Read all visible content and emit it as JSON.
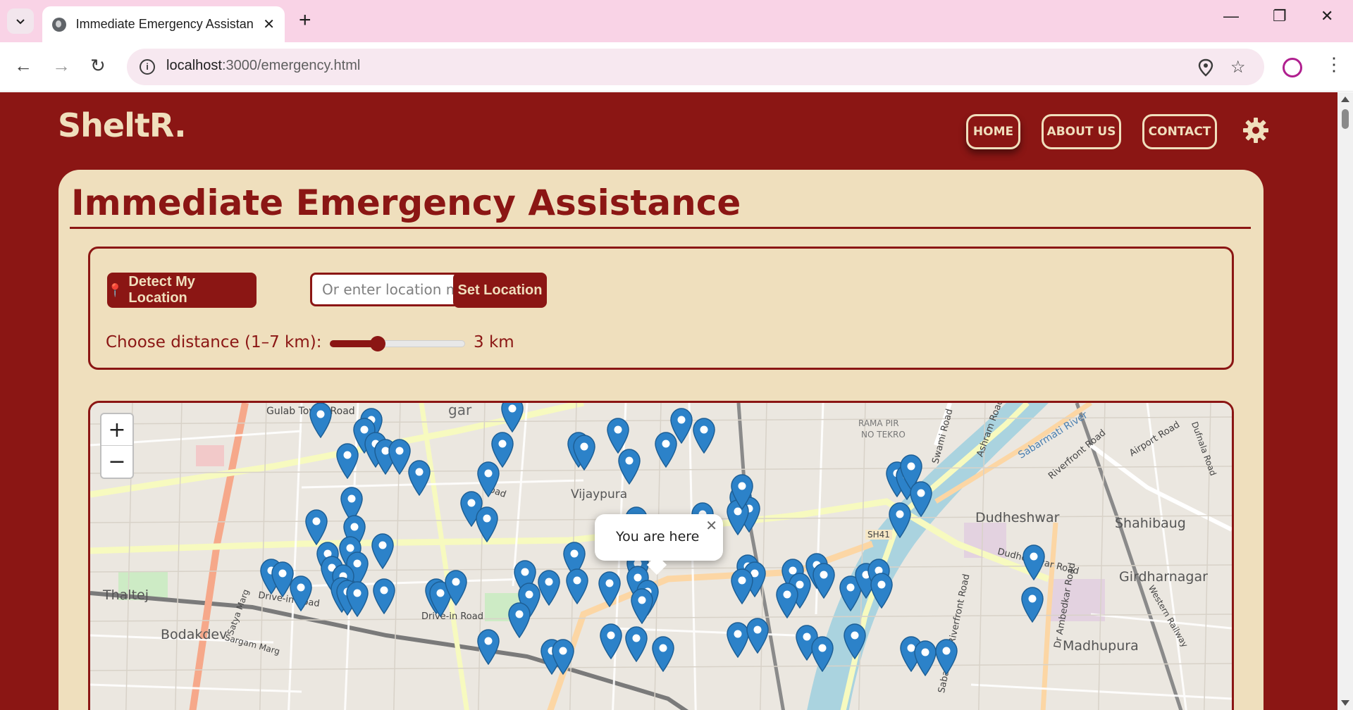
{
  "browser": {
    "tab_title": "Immediate Emergency Assistance",
    "url_host": "localhost",
    "url_path": ":3000/emergency.html"
  },
  "site": {
    "brand": "SheltR.",
    "nav": {
      "home": "HOME",
      "about": "ABOUT US",
      "contact": "CONTACT"
    }
  },
  "main": {
    "title": "Immediate Emergency Assistance",
    "detect_button": "Detect My Location",
    "location_placeholder": "Or enter location manually",
    "set_button": "Set Location",
    "distance_label": "Choose distance (1–7 km):",
    "distance_value": "3 km",
    "distance_km": 3,
    "distance_min": 1,
    "distance_max": 7
  },
  "map": {
    "zoom_in": "+",
    "zoom_out": "−",
    "popup_text": "You are here",
    "labels": {
      "gulab_tower_road": "Gulab Tower Road",
      "gar": "gar",
      "rama_pir": "RAMA PIR",
      "no_tekro": "NO TEKRO",
      "ashram_road": "Ashram Road",
      "sabarmati_river": "Sabarmati River",
      "riverfront_road": "Riverfront Road",
      "airport_road": "Airport Road",
      "dudheshwar": "Dudheshwar",
      "shahibaug": "Shahibaug",
      "girdharnagar": "Girdharnagar",
      "dudheshwar_road": "Dudheshwar Road",
      "vijaypura": "Vijaypura",
      "thaltej": "Thaltej",
      "bodakdev": "Bodakdev",
      "drive_in_road": "Drive-in Road",
      "drive_in_road2": "Drive-in Road",
      "sargam_marg": "Sargam Marg",
      "satya_marg": "Satya Marg",
      "madhupura": "Madhupura",
      "sh41": "SH41",
      "dr_ambedkar_road": "Dr Ambedkar Road",
      "western_railway": "Western Railway",
      "sabarmati_riverfront_road": "Sabarmati Riverfront Road",
      "road_small": "Road",
      "swami_road": "Swami Road",
      "dufnala_road": "Dufnala Road"
    }
  },
  "colors": {
    "primary": "#8b1614",
    "cream": "#efdfbd",
    "marker": "#2c82c9"
  }
}
